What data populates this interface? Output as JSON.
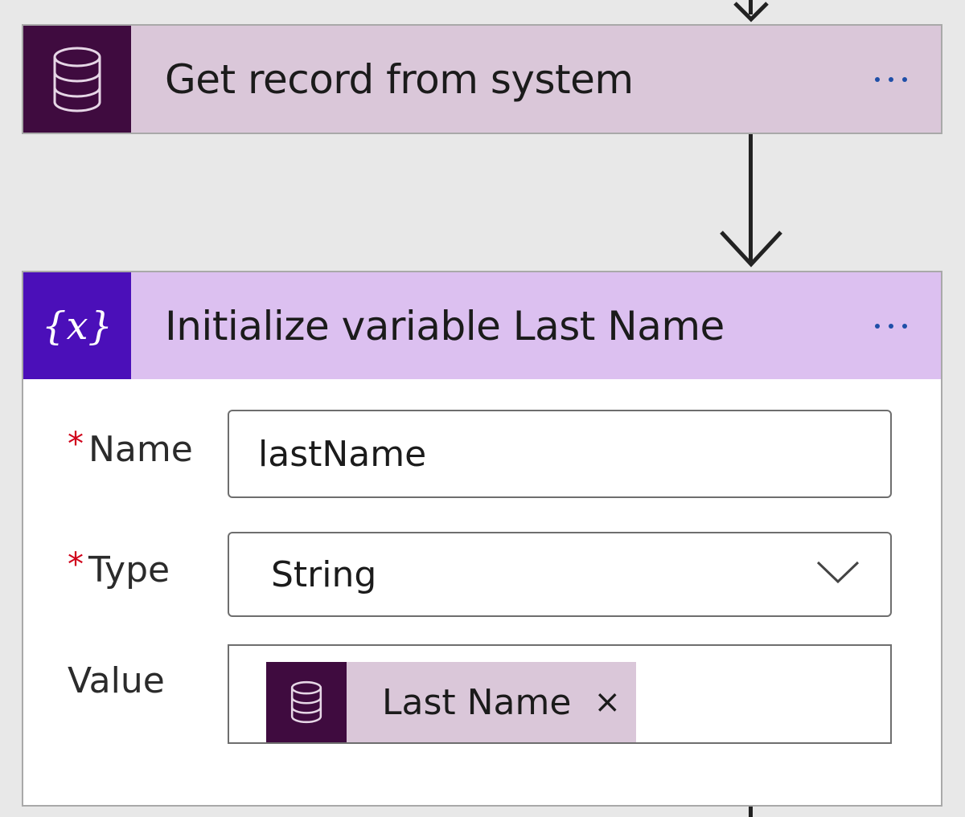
{
  "colors": {
    "canvas_bg": "#e8e8e8",
    "card1_header_bg": "#dac7d9",
    "card1_icon_bg": "#3f0b3f",
    "card2_header_bg": "#dcc0f0",
    "card2_icon_bg": "#4b0fb9",
    "more_dots": "#1f4fa8",
    "required_asterisk": "#d0021b"
  },
  "cards": [
    {
      "title": "Get record from system",
      "icon": "database-icon",
      "menu_icon": "more-options-icon"
    },
    {
      "title": "Initialize variable Last Name",
      "icon": "variable-icon",
      "icon_text": "{x}",
      "menu_icon": "more-options-icon",
      "fields": {
        "name": {
          "required_mark": "*",
          "label": "Name",
          "value": "lastName"
        },
        "type": {
          "required_mark": "*",
          "label": "Type",
          "value": "String",
          "icon": "chevron-down-icon"
        },
        "value": {
          "label": "Value",
          "token": {
            "label": "Last Name",
            "icon": "database-icon",
            "remove_glyph": "×"
          }
        }
      }
    }
  ]
}
